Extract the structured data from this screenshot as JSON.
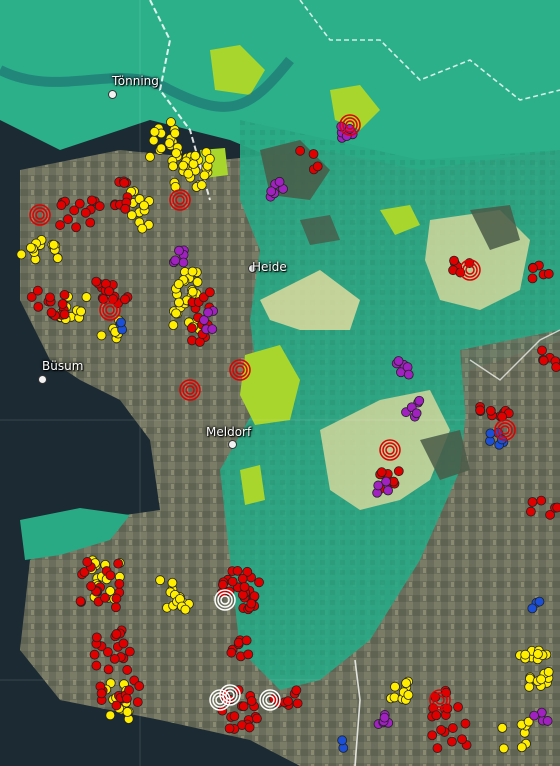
{
  "map": {
    "place_labels": [
      {
        "id": "toenning",
        "text": "Tönning"
      },
      {
        "id": "heide",
        "text": "Heide"
      },
      {
        "id": "buesum",
        "text": "Büsum"
      },
      {
        "id": "meldorf",
        "text": "Meldorf"
      }
    ],
    "colors": {
      "sea": "#1c2a33",
      "land": "#6d7360",
      "teal_zone": "#2aa985",
      "light_green_zone": "#a8d62c",
      "pale_zone": "#e8dfa0",
      "yellow_marker": "#ffee00",
      "red_marker": "#e00000",
      "purple_marker": "#a020c0",
      "blue_marker": "#1a4fd6",
      "white_marker": "#ffffff",
      "road_line": "#ffffff"
    },
    "marker_types": [
      "yellow-circle",
      "red-circle",
      "purple-circle",
      "blue-circle",
      "white-ring",
      "red-ring"
    ]
  }
}
